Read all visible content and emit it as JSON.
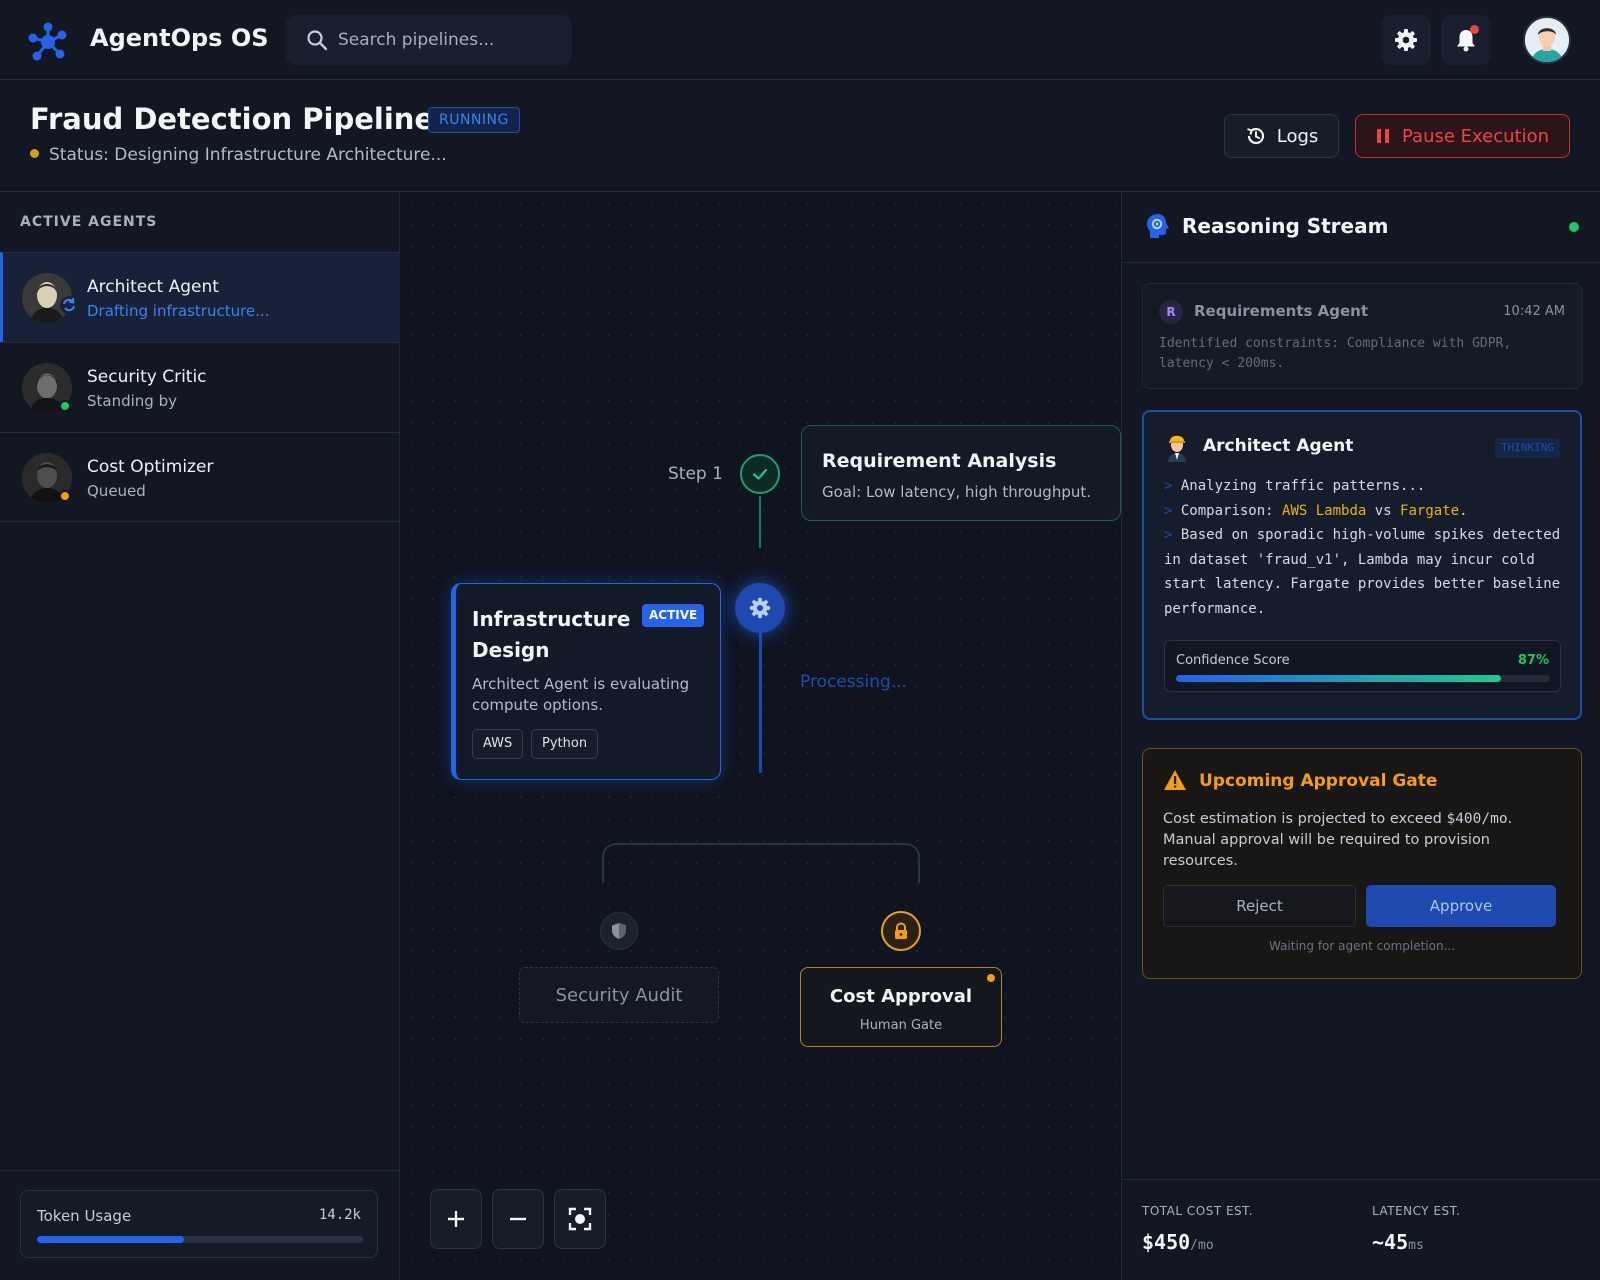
{
  "app": {
    "title": "AgentOps OS"
  },
  "search": {
    "placeholder": "Search pipelines..."
  },
  "header_icons": [
    "gear-icon",
    "bell-icon"
  ],
  "pipeline": {
    "title": "Fraud Detection Pipeline v2",
    "state_badge": "RUNNING",
    "status": "Status: Designing Infrastructure Architecture...",
    "logs_label": "Logs",
    "pause_label": "Pause Execution"
  },
  "sidebar": {
    "heading": "ACTIVE AGENTS",
    "agents": [
      {
        "name": "Architect Agent",
        "status": "Drafting infrastructure..."
      },
      {
        "name": "Security Critic",
        "status": "Standing by"
      },
      {
        "name": "Cost Optimizer",
        "status": "Queued"
      }
    ],
    "token_usage": {
      "label": "Token Usage",
      "value": "14.2k",
      "fraction": 0.45
    }
  },
  "canvas": {
    "step1_label": "Step 1",
    "requirement": {
      "title": "Requirement Analysis",
      "goal": "Goal: Low latency, high throughput."
    },
    "infra": {
      "title": "Infrastructure Design",
      "badge": "ACTIVE",
      "desc": "Architect Agent is evaluating compute options.",
      "tags": [
        "AWS",
        "Python"
      ]
    },
    "processing": "Processing...",
    "security_audit": "Security Audit",
    "cost_approval": {
      "title": "Cost Approval",
      "sub": "Human Gate"
    }
  },
  "reasoning": {
    "title": "Reasoning Stream",
    "req_msg": {
      "initial": "R",
      "agent": "Requirements Agent",
      "time": "10:42 AM",
      "text": "Identified constraints: Compliance with GDPR, latency < 200ms."
    },
    "arch_msg": {
      "agent": "Architect Agent",
      "badge": "THINKING",
      "line1": "Analyzing traffic patterns...",
      "line2_prefix": "Comparison: ",
      "line2_a": "AWS Lambda",
      "line2_mid": " vs ",
      "line2_b": "Fargate",
      "line2_end": ".",
      "line3": "Based on sporadic high-volume spikes detected in dataset 'fraud_v1', Lambda may incur cold start latency. Fargate provides better baseline performance.",
      "confidence_label": "Confidence Score",
      "confidence_value": "87%",
      "confidence_fraction": 0.87
    }
  },
  "gate": {
    "title": "Upcoming Approval Gate",
    "body_prefix": "Cost estimation is projected to exceed ",
    "amount": "$400/mo",
    "body_suffix": ". Manual approval will be required to provision resources.",
    "reject": "Reject",
    "approve": "Approve",
    "waiting": "Waiting for agent completion..."
  },
  "stats": {
    "cost_label": "TOTAL COST EST.",
    "cost_value": "$450",
    "cost_unit": "/mo",
    "latency_label": "LATENCY EST.",
    "latency_value": "~45",
    "latency_unit": "ms"
  },
  "colors": {
    "accent": "#2563eb",
    "success": "#22c55e",
    "warning": "#f59e0b",
    "danger": "#ef4444"
  }
}
